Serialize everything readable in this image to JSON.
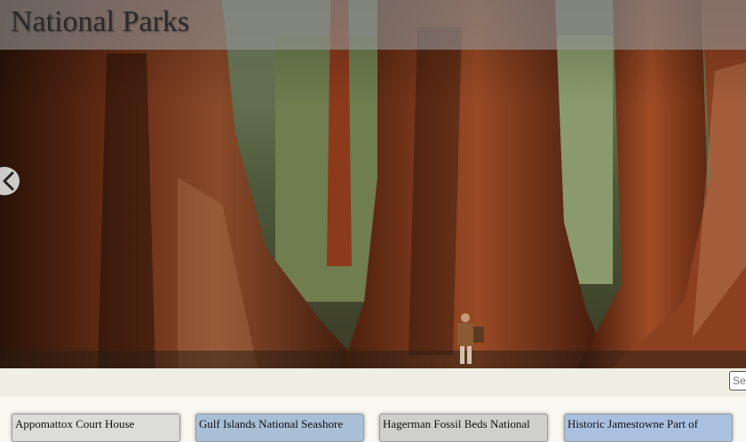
{
  "header": {
    "title": "National Parks"
  },
  "carousel": {
    "prev_icon": "chevron-left-icon"
  },
  "search": {
    "placeholder": "Search"
  },
  "parks": [
    {
      "name": "Appomattox Court House",
      "color": "#dcdcd8"
    },
    {
      "name": "Gulf Islands National Seashore",
      "color": "#a8bfd6"
    },
    {
      "name": "Hagerman Fossil Beds National",
      "color": "#cfcfcb"
    },
    {
      "name": "Historic Jamestowne Part of",
      "color": "#a9c0e0"
    }
  ]
}
